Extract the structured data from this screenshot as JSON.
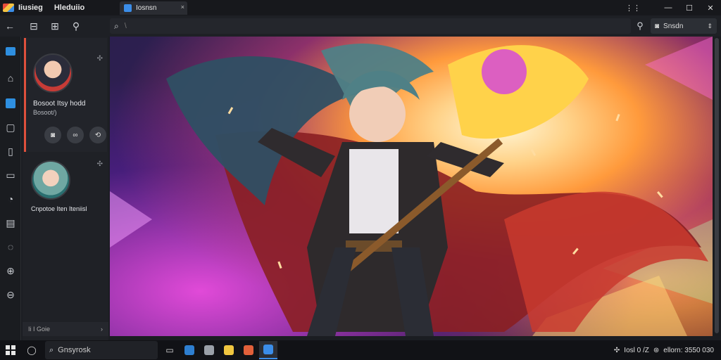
{
  "titlebar": {
    "app_name": "Iiusieg",
    "menu": "Hleduiio",
    "tab_label": "Iosnsn",
    "tab_close": "×",
    "controls": {
      "more": "⋮⋮",
      "minimize": "—",
      "maximize": "☐",
      "close": "✕"
    }
  },
  "toolbar": {
    "back": "←",
    "search_placeholder": "\\",
    "dropdown_label": "Snsdn"
  },
  "sidepanel": {
    "cards": [
      {
        "name": "Bosoot Itsy hodd",
        "sub": "Bosoot/)"
      },
      {
        "name": "Cnpotoe Iten Iteniisl"
      }
    ],
    "footer_label": "Ii  I  Goie",
    "footer_chev": "›"
  },
  "taskbar": {
    "search_label": "Gnsyrosk",
    "tray_text": "Iosl 0  /Z",
    "tray_clock": "ellorn: 3550 030"
  },
  "colors": {
    "accent": "#3b8de8",
    "selected_border": "#e0503c"
  }
}
